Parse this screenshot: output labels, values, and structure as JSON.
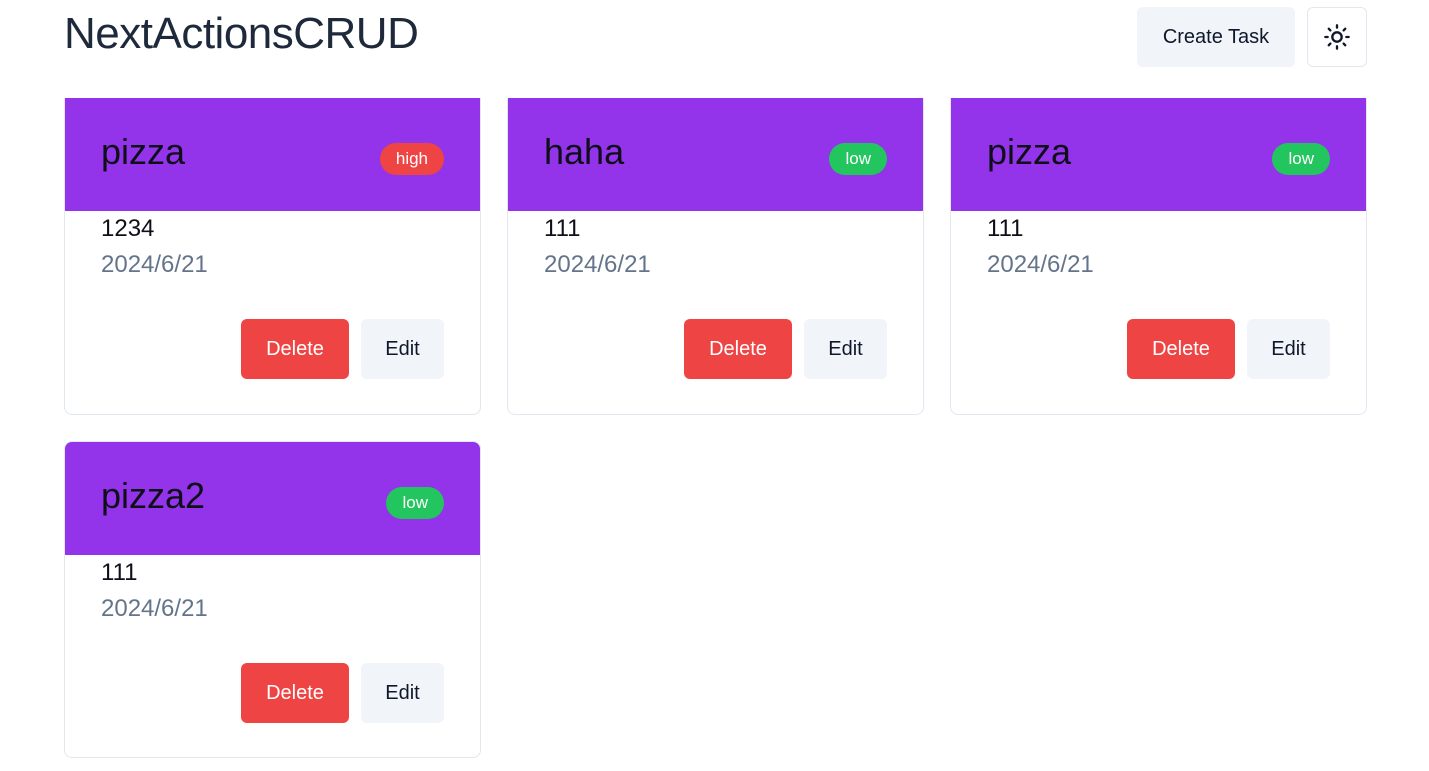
{
  "header": {
    "title": "NextActionsCRUD",
    "create_label": "Create Task",
    "theme_icon": "sun-icon"
  },
  "colors": {
    "card_header": "#9333ea",
    "priority_high": "#ef4444",
    "priority_low": "#22c55e",
    "delete_button": "#ef4444",
    "secondary_button": "#f1f5f9"
  },
  "tasks": [
    {
      "title": "pizza",
      "priority": "high",
      "description": "1234",
      "date": "2024/6/21",
      "delete_label": "Delete",
      "edit_label": "Edit"
    },
    {
      "title": "haha",
      "priority": "low",
      "description": "111",
      "date": "2024/6/21",
      "delete_label": "Delete",
      "edit_label": "Edit"
    },
    {
      "title": "pizza",
      "priority": "low",
      "description": "111",
      "date": "2024/6/21",
      "delete_label": "Delete",
      "edit_label": "Edit"
    },
    {
      "title": "pizza2",
      "priority": "low",
      "description": "111",
      "date": "2024/6/21",
      "delete_label": "Delete",
      "edit_label": "Edit"
    }
  ]
}
